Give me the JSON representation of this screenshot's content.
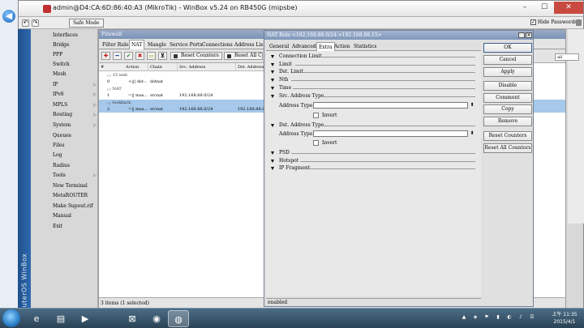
{
  "window": {
    "title": "admin@D4:CA:6D:86:40:A3 (MikroTik) - WinBox v5.24 on RB450G (mipsbe)",
    "minimize": "–",
    "maximize": "☐",
    "close": "✕"
  },
  "toolbar": {
    "undo": "↶",
    "redo": "↷",
    "safe_mode": "Safe Mode",
    "hide_passwords": "Hide Passwords",
    "hide_passwords_checked": "✓"
  },
  "brand": "RouterOS WinBox",
  "menu": [
    {
      "label": "Interfaces",
      "arrow": ""
    },
    {
      "label": "Bridge",
      "arrow": ""
    },
    {
      "label": "PPP",
      "arrow": ""
    },
    {
      "label": "Switch",
      "arrow": ""
    },
    {
      "label": "Mesh",
      "arrow": ""
    },
    {
      "label": "IP",
      "arrow": "▷"
    },
    {
      "label": "IPv6",
      "arrow": "▷"
    },
    {
      "label": "MPLS",
      "arrow": "▷"
    },
    {
      "label": "Routing",
      "arrow": "▷"
    },
    {
      "label": "System",
      "arrow": "▷"
    },
    {
      "label": "Queues",
      "arrow": ""
    },
    {
      "label": "Files",
      "arrow": ""
    },
    {
      "label": "Log",
      "arrow": ""
    },
    {
      "label": "Radius",
      "arrow": ""
    },
    {
      "label": "Tools",
      "arrow": "▷"
    },
    {
      "label": "New Terminal",
      "arrow": ""
    },
    {
      "label": "MetaROUTER",
      "arrow": ""
    },
    {
      "label": "Make Supout.rif",
      "arrow": ""
    },
    {
      "label": "Manual",
      "arrow": ""
    },
    {
      "label": "Exit",
      "arrow": ""
    }
  ],
  "firewall": {
    "title": "Firewall",
    "tabs": [
      "Filter Rules",
      "NAT",
      "Mangle",
      "Service Ports",
      "Connections",
      "Address Lists"
    ],
    "buttons": {
      "add": "✚",
      "remove": "━",
      "enable": "✔",
      "disable": "✖",
      "comment": "▭",
      "filter": "⊻"
    },
    "reset_counters": "Reset Counters",
    "reset_all": "Reset All C",
    "search_value": "",
    "search2_value": "all",
    "columns": [
      "#",
      "Action",
      "Chain",
      "Src. Address",
      "Dst. Address"
    ],
    "rows": [
      {
        "type": "comment",
        "text": ";;; 15 web"
      },
      {
        "type": "rule",
        "num": "0",
        "action": "+||| dst-...",
        "chain": "dstnat",
        "src": "",
        "dst": ""
      },
      {
        "type": "comment",
        "text": ";;; NAT"
      },
      {
        "type": "rule",
        "num": "1",
        "action": "=|| mas...",
        "chain": "srcnat",
        "src": "192.168.88.0/24",
        "dst": ""
      },
      {
        "type": "comment",
        "text": ";;; lookback",
        "selected": true
      },
      {
        "type": "rule",
        "num": "2",
        "action": "=|| mas...",
        "chain": "srcnat",
        "src": "192.168.88.0/24",
        "dst": "192.168.88.0/24",
        "selected": true
      }
    ],
    "status": "3 items (1 selected)"
  },
  "dialog": {
    "title": "NAT Rule <192.168.88.0/24->192.168.88.15>",
    "close": "✕",
    "tabs": [
      "General",
      "Advanced",
      "Extra",
      "Action",
      "Statistics"
    ],
    "active_tab": "Extra",
    "sections": {
      "connection_limit": "Connection Limit",
      "limit": "Limit",
      "dst_limit": "Dst. Limit",
      "nth": "Nth",
      "time": "Time",
      "src_address_type": "Src. Address Type",
      "dst_address_type": "Dst. Address Type",
      "psd": "PSD",
      "hotspot": "Hotspot",
      "ip_fragment": "IP Fragment"
    },
    "address_type_label": "Address Type:",
    "invert_label": "Invert",
    "field_arrow": "⬍",
    "status": "enabled",
    "buttons": [
      "OK",
      "Cancel",
      "Apply",
      "Disable",
      "Comment",
      "Copy",
      "Remove",
      "Reset Counters",
      "Reset All Counters"
    ]
  },
  "taskbar": {
    "start": "",
    "apps": [
      {
        "icon": "e",
        "name": "ie"
      },
      {
        "icon": "▤",
        "name": "explorer"
      },
      {
        "icon": "▶",
        "name": "media"
      },
      {
        "icon": "⊠",
        "name": "app4"
      },
      {
        "icon": "◉",
        "name": "app5"
      },
      {
        "icon": "◍",
        "name": "winbox"
      }
    ],
    "tray_icons": [
      "▲",
      "◈",
      "⚑",
      "▮",
      "◐",
      "♪",
      "☰"
    ],
    "time": "上午 11:35",
    "date": "2015/4/1"
  }
}
